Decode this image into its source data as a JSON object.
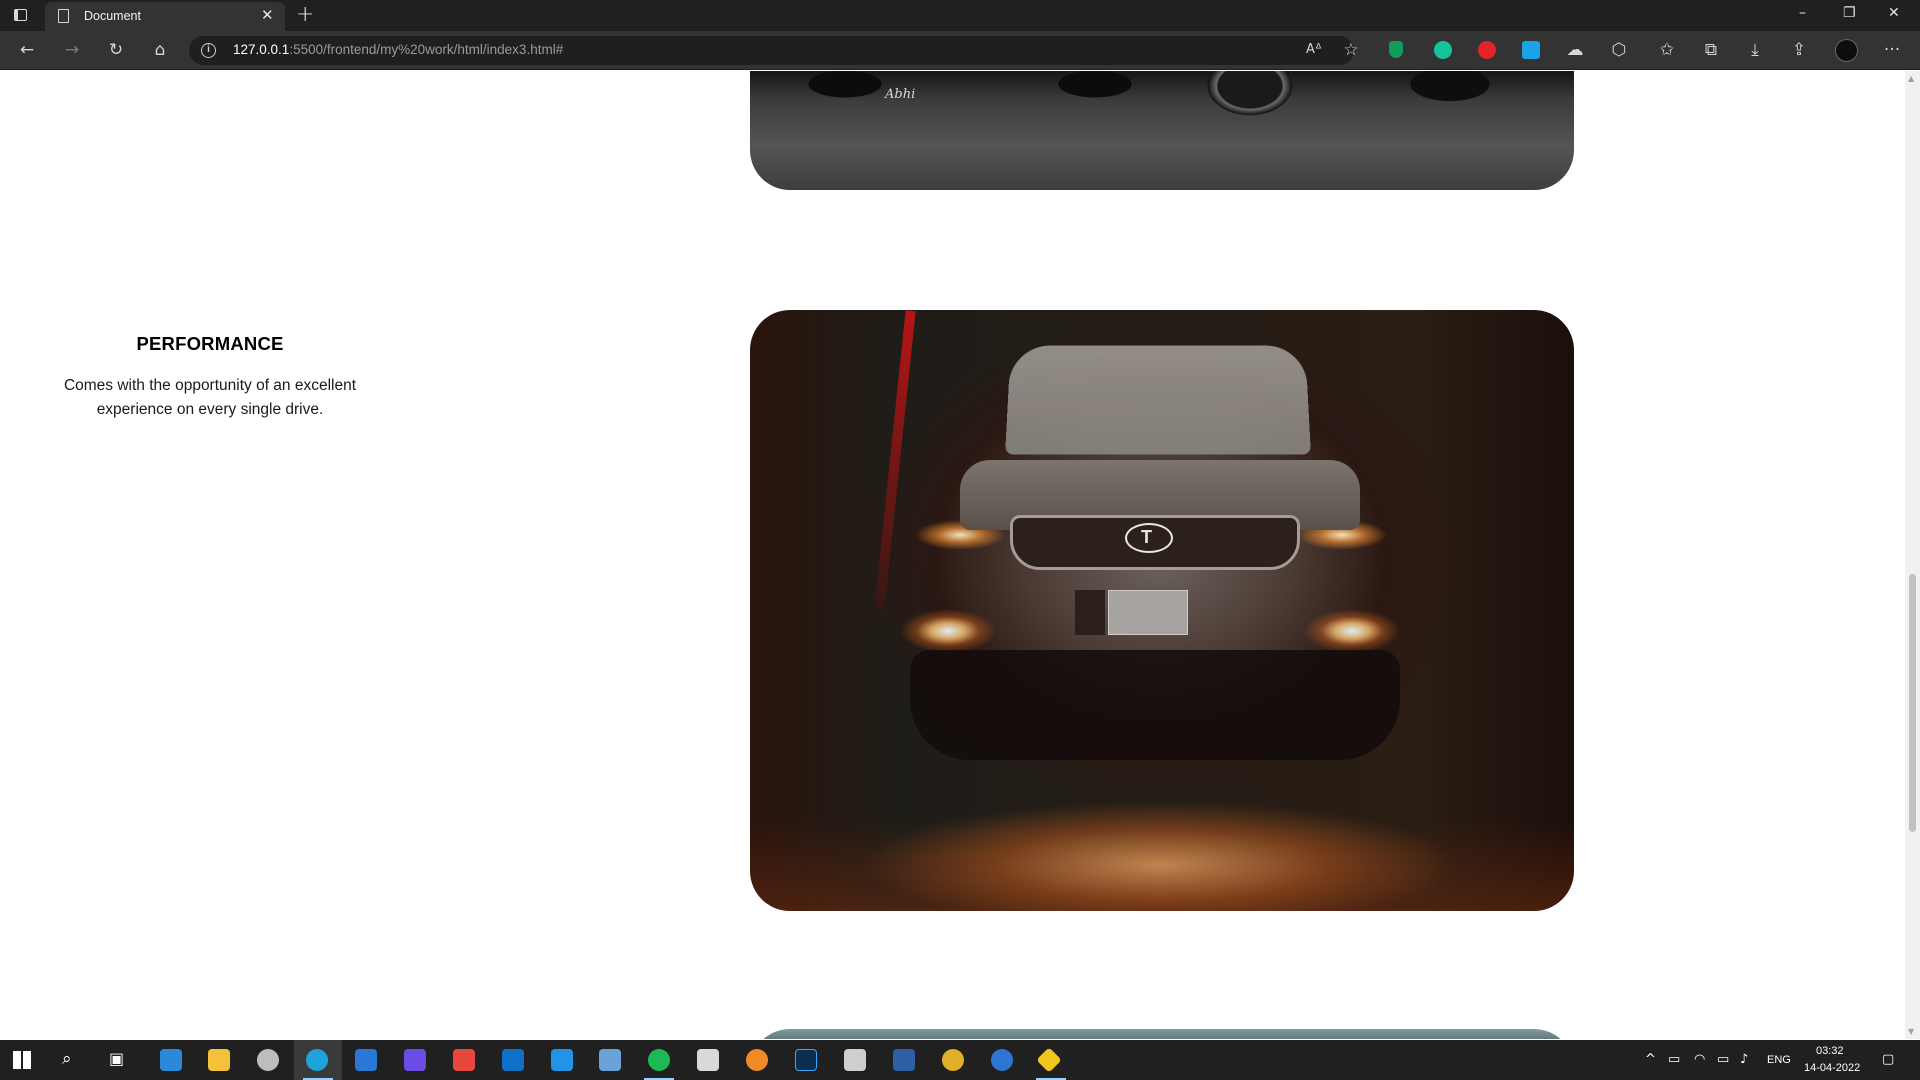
{
  "browser": {
    "tab_title": "Document",
    "new_tab": "+",
    "close_tab": "✕",
    "url_host": "127.0.0.1",
    "url_path": ":5500/frontend/my%20work/html/index3.html#",
    "window_controls": {
      "minimize": "–",
      "restore": "❐",
      "close": "✕"
    },
    "toolbar_icons": [
      "back-icon",
      "forward-icon",
      "refresh-icon",
      "home-icon"
    ],
    "address_icons": [
      "read-aloud-icon",
      "favorite-add-icon"
    ],
    "extensions": [
      "extension-shield-icon",
      "grammarly-icon",
      "extension-red-icon",
      "extension-translate-icon",
      "extension-cloud-icon",
      "extensions-puzzle-icon"
    ],
    "right_icons": [
      "favorites-icon",
      "collections-icon",
      "downloads-icon",
      "share-icon",
      "profile-avatar",
      "more-icon"
    ],
    "more_label": "···"
  },
  "page": {
    "feature_title": "PERFORMANCE",
    "feature_desc": "Comes with the opportunity of an excellent experience on every single drive.",
    "signature": "Abhi"
  },
  "taskbar": {
    "apps": [
      "start-icon",
      "search-icon",
      "task-view-icon",
      "store-icon",
      "file-explorer-icon",
      "database-icon",
      "edge-icon",
      "mail-icon",
      "visual-studio-icon",
      "anydesk-icon",
      "outlook-icon",
      "vscode-icon",
      "virtualbox-icon",
      "spotify-icon",
      "terminal-icon",
      "blender-icon",
      "photoshop-icon",
      "unity-icon",
      "mysql-workbench-icon",
      "chrome-canary-icon",
      "app-w-icon",
      "git-icon"
    ],
    "tray": {
      "language": "ENG",
      "time": "03:32",
      "date": "14-04-2022"
    }
  }
}
